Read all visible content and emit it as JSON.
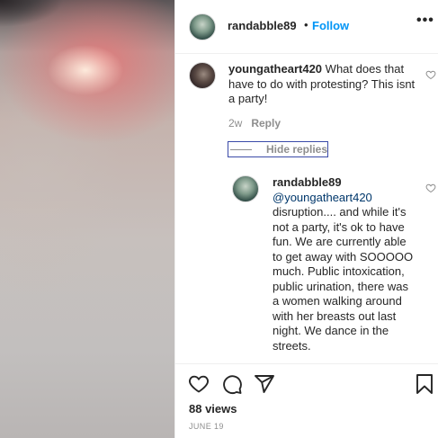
{
  "post": {
    "username": "randabble89",
    "separator": "•",
    "follow_label": "Follow",
    "more_label": "•••"
  },
  "comments": [
    {
      "username": "youngatheart420",
      "text": "What does that have to do with protesting? This isnt a party!",
      "time": "2w",
      "reply_label": "Reply",
      "hide_replies_label": "Hide replies"
    }
  ],
  "replies": [
    {
      "username": "randabble89",
      "mention": "@youngatheart420",
      "text": "disruption.... and while it's not a party, it's ok to have fun. We are currently able to get away with SOOOOO much. Public intoxication, public urination, there was a women walking around with her breasts out last night. We dance in the streets."
    }
  ],
  "footer": {
    "views": "88 views",
    "date": "JUNE 19"
  },
  "icons": [
    "heart-icon",
    "comment-icon",
    "share-icon",
    "bookmark-icon",
    "more-icon"
  ],
  "colors": {
    "follow": "#0095f6",
    "mention": "#00376b",
    "muted": "#8e8e8e"
  }
}
